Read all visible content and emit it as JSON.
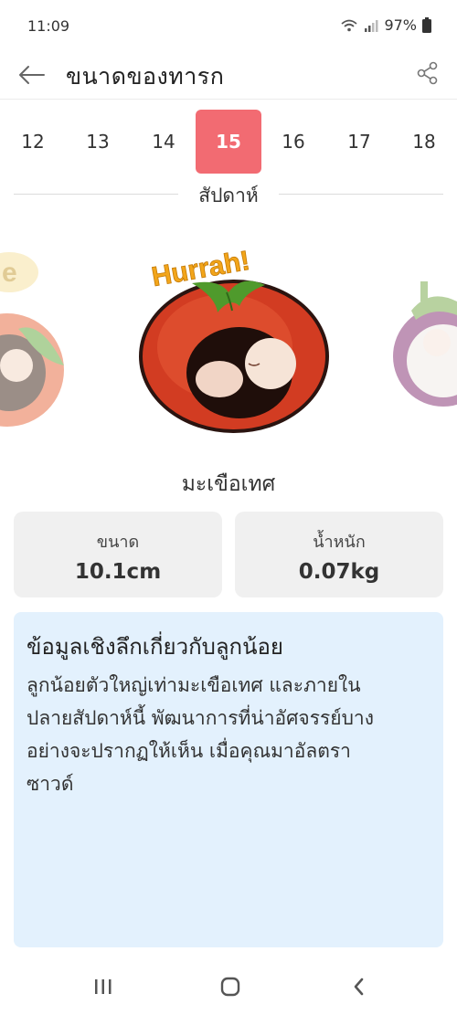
{
  "status": {
    "time": "11:09",
    "battery": "97%"
  },
  "header": {
    "title": "ขนาดของทารก",
    "back_icon": "arrow-left-icon",
    "share_icon": "share-icon"
  },
  "weeks": {
    "items": [
      "12",
      "13",
      "14",
      "15",
      "16",
      "17",
      "18"
    ],
    "selected": "15",
    "caption": "สัปดาห์"
  },
  "illustration": {
    "banner": "Hurrah!",
    "left_banner_partial": "e"
  },
  "fruit": {
    "name": "มะเขือเทศ"
  },
  "stats": {
    "size": {
      "label": "ขนาด",
      "value": "10.1cm"
    },
    "weight": {
      "label": "น้ำหนัก",
      "value": "0.07kg"
    }
  },
  "insight": {
    "title": "ข้อมูลเชิงลึกเกี่ยวกับลูกน้อย",
    "lines": [
      "ลูกน้อยตัวใหญ่เท่ามะเขือเทศ และภายใน",
      "ปลายสัปดาห์นี้ พัฒนาการที่น่าอัศจรรย์บาง",
      "อย่างจะปรากฏให้เห็น เมื่อคุณมาอัลตรา",
      "ซาวด์"
    ]
  },
  "colors": {
    "accent": "#f26b72",
    "card": "#f0f0f0",
    "insight_bg": "#e3f1fd"
  }
}
